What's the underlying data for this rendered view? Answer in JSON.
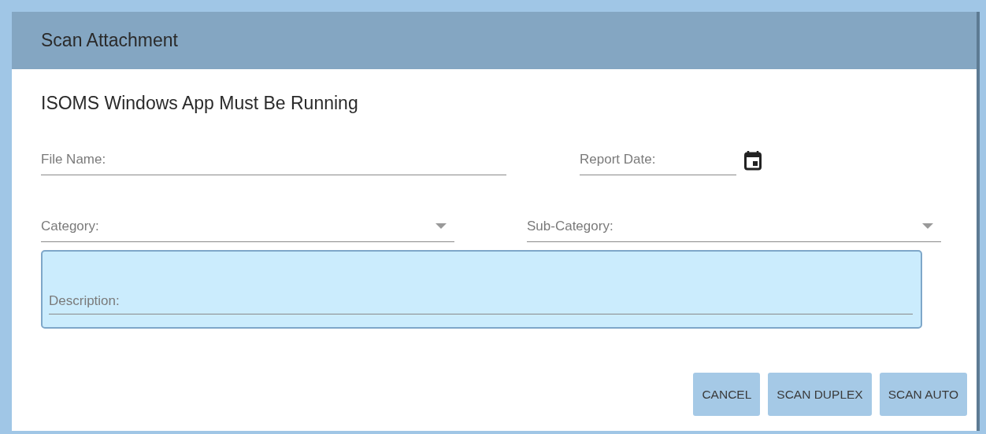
{
  "dialog": {
    "title": "Scan Attachment",
    "notice": "ISOMS Windows App Must Be Running"
  },
  "fields": [
    {
      "kind": "text",
      "placeholder": "File Name:"
    },
    {
      "kind": "date",
      "placeholder": "Report Date:"
    },
    {
      "kind": "select",
      "placeholder": "Category:"
    },
    {
      "kind": "select",
      "placeholder": "Sub-Category:"
    },
    {
      "kind": "textarea",
      "placeholder": "Description:"
    }
  ],
  "buttons": [
    "CANCEL",
    "SCAN DUPLEX",
    "SCAN AUTO"
  ]
}
